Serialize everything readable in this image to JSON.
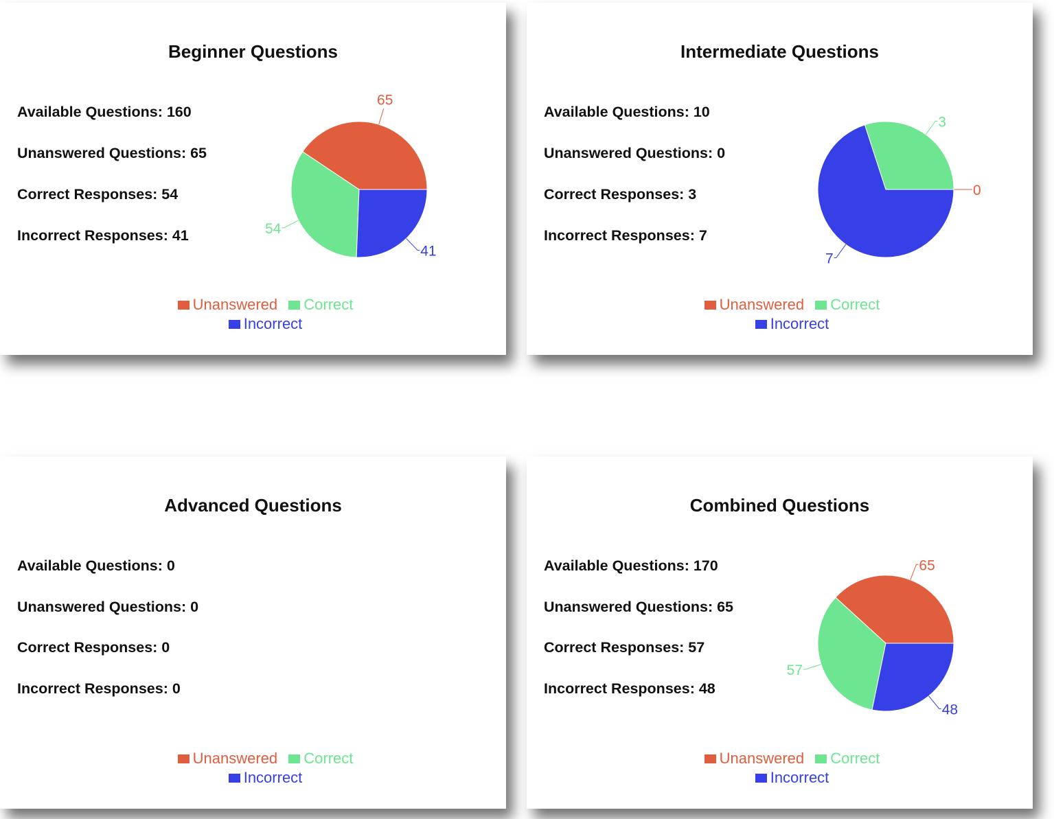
{
  "colors": {
    "unanswered": "#e05d3e",
    "correct": "#6ee591",
    "incorrect": "#3740e6"
  },
  "legend": {
    "unanswered": "Unanswered",
    "correct": "Correct",
    "incorrect": "Incorrect"
  },
  "chart_data": [
    {
      "type": "pie",
      "title": "Beginner Questions",
      "stats": {
        "available": "Available Questions: 160",
        "unanswered": "Unanswered Questions: 65",
        "correct": "Correct Responses: 54",
        "incorrect": "Incorrect Responses: 41"
      },
      "categories": [
        "Unanswered",
        "Correct",
        "Incorrect"
      ],
      "values": [
        65,
        54,
        41
      ],
      "legend_position": "bottom-right"
    },
    {
      "type": "pie",
      "title": "Intermediate Questions",
      "stats": {
        "available": "Available Questions: 10",
        "unanswered": "Unanswered Questions: 0",
        "correct": "Correct Responses: 3",
        "incorrect": "Incorrect Responses: 7"
      },
      "categories": [
        "Unanswered",
        "Correct",
        "Incorrect"
      ],
      "values": [
        0,
        3,
        7
      ],
      "legend_position": "bottom-right"
    },
    {
      "type": "pie",
      "title": "Advanced Questions",
      "stats": {
        "available": "Available Questions: 0",
        "unanswered": "Unanswered Questions: 0",
        "correct": "Correct Responses: 0",
        "incorrect": "Incorrect Responses: 0"
      },
      "categories": [
        "Unanswered",
        "Correct",
        "Incorrect"
      ],
      "values": [
        0,
        0,
        0
      ],
      "legend_position": "bottom-right"
    },
    {
      "type": "pie",
      "title": "Combined Questions",
      "stats": {
        "available": "Available Questions: 170",
        "unanswered": "Unanswered Questions: 65",
        "correct": "Correct Responses: 57",
        "incorrect": "Incorrect Responses: 48"
      },
      "categories": [
        "Unanswered",
        "Correct",
        "Incorrect"
      ],
      "values": [
        65,
        57,
        48
      ],
      "legend_position": "bottom-right"
    }
  ]
}
